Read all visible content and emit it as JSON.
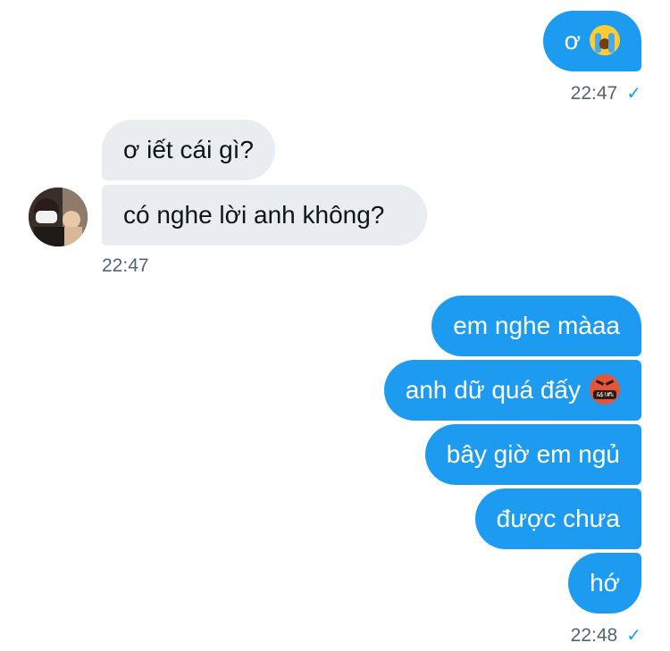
{
  "conversation": {
    "messages": [
      {
        "side": "sent",
        "text": "ơ",
        "emoji": "loudly-crying-face"
      },
      {
        "side": "received",
        "text": "ơ iết cái gì?"
      },
      {
        "side": "received",
        "text": "có nghe lời anh không?"
      },
      {
        "side": "sent",
        "text": "em nghe màaa"
      },
      {
        "side": "sent",
        "text": "anh dữ quá đấy",
        "emoji": "face-with-symbols-on-mouth"
      },
      {
        "side": "sent",
        "text": "bây giờ em ngủ"
      },
      {
        "side": "sent",
        "text": "được chưa"
      },
      {
        "side": "sent",
        "text": "hớ"
      }
    ],
    "timestamps": {
      "first_sent": "22:47",
      "received": "22:47",
      "last_sent": "22:48"
    },
    "read_receipt_icon": "check-icon",
    "emoji_angry_text": "&$!#%"
  },
  "colors": {
    "sent_bubble": "#1d9bf0",
    "received_bubble": "#e9ecf0",
    "timestamp": "#536471",
    "check": "#1d9bf0"
  }
}
